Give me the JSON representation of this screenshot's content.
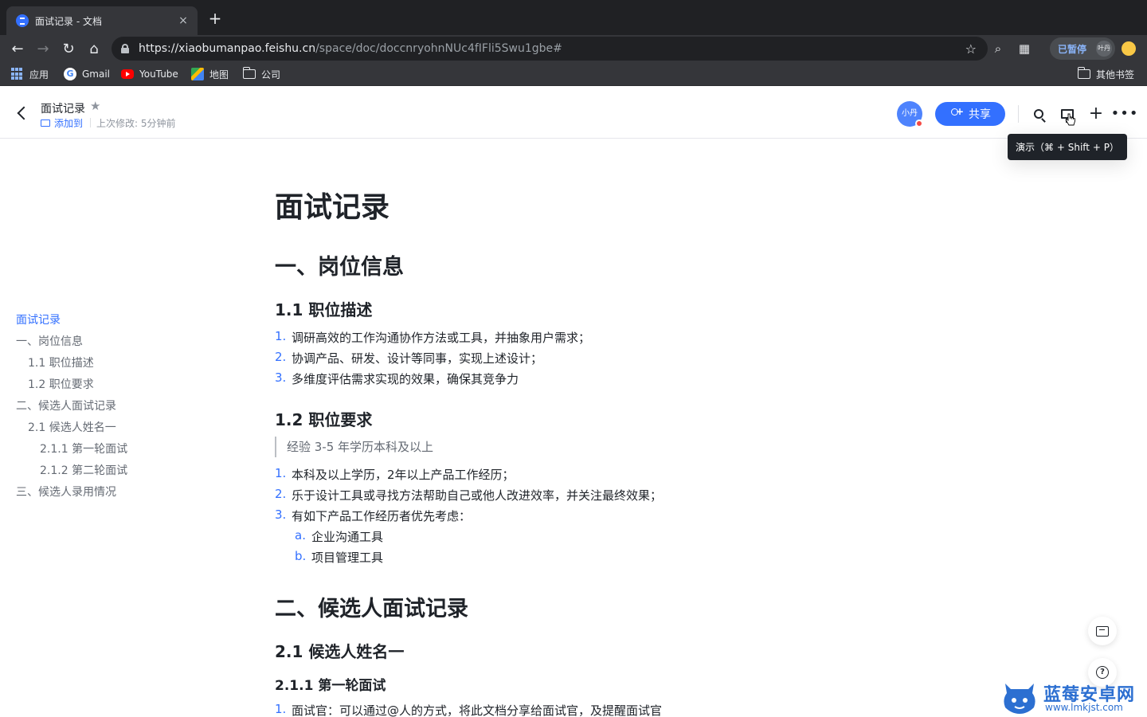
{
  "browser": {
    "tab_title": "面试记录 - 文档",
    "tab_close": "×",
    "new_tab": "+",
    "url_host": "https://xiaobumanpao.feishu.cn",
    "url_path": "/space/doc/doccnryohnNUc4fIFli5Swu1gbe#",
    "paused_label": "已暂停",
    "paused_avatar": "叶丹",
    "bookmarks": [
      {
        "label": "应用",
        "icon": "apps-grid-icon"
      },
      {
        "label": "Gmail",
        "icon": "google-icon"
      },
      {
        "label": "YouTube",
        "icon": "youtube-icon"
      },
      {
        "label": "地图",
        "icon": "maps-icon"
      },
      {
        "label": "公司",
        "icon": "folder-icon"
      }
    ],
    "other_bookmarks": "其他书签"
  },
  "header": {
    "doc_title": "面试记录",
    "add_to_label": "添加到",
    "last_modified": "上次修改: 5分钟前",
    "collaborator_initials": "小丹",
    "share_label": "共享",
    "tooltip": "演示（⌘ + Shift + P）"
  },
  "outline": [
    {
      "label": "面试记录",
      "level": 1,
      "active": true
    },
    {
      "label": "一、岗位信息",
      "level": 1,
      "active": false
    },
    {
      "label": "1.1 职位描述",
      "level": 2,
      "active": false
    },
    {
      "label": "1.2 职位要求",
      "level": 2,
      "active": false
    },
    {
      "label": "二、候选人面试记录",
      "level": 1,
      "active": false
    },
    {
      "label": "2.1 候选人姓名一",
      "level": 2,
      "active": false
    },
    {
      "label": "2.1.1 第一轮面试",
      "level": 3,
      "active": false
    },
    {
      "label": "2.1.2 第二轮面试",
      "level": 3,
      "active": false
    },
    {
      "label": "三、候选人录用情况",
      "level": 1,
      "active": false
    }
  ],
  "document": {
    "title": "面试记录",
    "sec1_heading": "一、岗位信息",
    "sub11_heading": "1.1 职位描述",
    "sub11_items": [
      {
        "num": "1.",
        "text": "调研高效的工作沟通协作方法或工具，并抽象用户需求；"
      },
      {
        "num": "2.",
        "text": "协调产品、研发、设计等同事，实现上述设计；"
      },
      {
        "num": "3.",
        "text": "多维度评估需求实现的效果，确保其竞争力"
      }
    ],
    "sub12_heading": "1.2 职位要求",
    "sub12_quote": "经验 3-5 年学历本科及以上",
    "sub12_items": [
      {
        "num": "1.",
        "text": "本科及以上学历，2年以上产品工作经历；"
      },
      {
        "num": "2.",
        "text": "乐于设计工具或寻找方法帮助自己或他人改进效率，并关注最终效果；"
      },
      {
        "num": "3.",
        "text": "有如下产品工作经历者优先考虑："
      }
    ],
    "sub12_subitems": [
      {
        "num": "a.",
        "text": "企业沟通工具"
      },
      {
        "num": "b.",
        "text": "项目管理工具"
      }
    ],
    "sec2_heading": "二、候选人面试记录",
    "sub21_heading": "2.1 候选人姓名一",
    "sub211_heading": "2.1.1 第一轮面试",
    "sub211_items": [
      {
        "num": "1.",
        "text": "面试官：可以通过@人的方式，将此文档分享给面试官，及提醒面试官"
      }
    ]
  },
  "watermark": {
    "name": "蓝莓安卓网",
    "url": "www.lmkjst.com"
  },
  "colors": {
    "accent": "#3370ff",
    "browser_dark": "#202124",
    "text": "#1f2329",
    "muted": "#646a73"
  }
}
